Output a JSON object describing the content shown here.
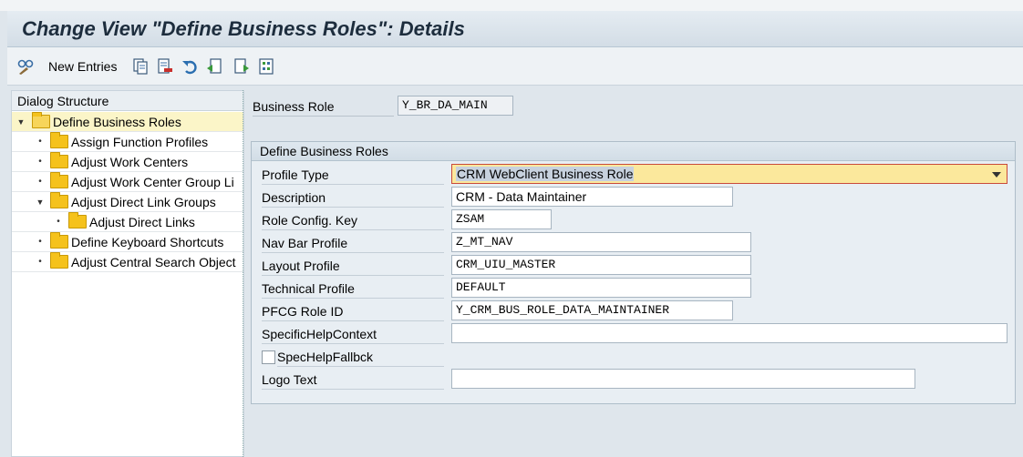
{
  "title": "Change View \"Define Business Roles\": Details",
  "toolbar": {
    "new_entries_label": "New Entries",
    "icons": [
      "glasses-icon",
      "copy-icon",
      "delete-icon",
      "undo-icon",
      "prev-entry-icon",
      "next-entry-icon",
      "select-block-icon"
    ]
  },
  "dialog_structure": {
    "header": "Dialog Structure",
    "items": [
      {
        "label": "Define Business Roles",
        "level": 0,
        "expanded": true,
        "selected": true
      },
      {
        "label": "Assign Function Profiles",
        "level": 1
      },
      {
        "label": "Adjust Work Centers",
        "level": 1
      },
      {
        "label": "Adjust Work Center Group Li",
        "level": 1
      },
      {
        "label": "Adjust Direct Link Groups",
        "level": 1,
        "expanded": true
      },
      {
        "label": "Adjust Direct Links",
        "level": 2
      },
      {
        "label": "Define Keyboard Shortcuts",
        "level": 1
      },
      {
        "label": "Adjust Central Search Object",
        "level": 1
      }
    ]
  },
  "business_role": {
    "label": "Business Role",
    "value": "Y_BR_DA_MAIN"
  },
  "group": {
    "title": "Define Business Roles",
    "fields": {
      "profile_type": {
        "label": "Profile Type",
        "value": "CRM WebClient Business Role"
      },
      "description": {
        "label": "Description",
        "value": "CRM - Data Maintainer"
      },
      "role_config_key": {
        "label": "Role Config. Key",
        "value": "ZSAM"
      },
      "nav_bar_profile": {
        "label": "Nav Bar Profile",
        "value": "Z_MT_NAV"
      },
      "layout_profile": {
        "label": "Layout Profile",
        "value": "CRM_UIU_MASTER"
      },
      "technical_profile": {
        "label": "Technical Profile",
        "value": "DEFAULT"
      },
      "pfcg_role_id": {
        "label": "PFCG Role ID",
        "value": "Y_CRM_BUS_ROLE_DATA_MAINTAINER"
      },
      "specific_help_context": {
        "label": "SpecificHelpContext",
        "value": ""
      },
      "spec_help_fallback": {
        "label": "SpecHelpFallbck",
        "checked": false
      },
      "logo_text": {
        "label": "Logo Text",
        "value": ""
      }
    }
  },
  "colors": {
    "selected_row": "#fbf5c8",
    "folder": "#f5c21c",
    "dropdown_bg": "#fbe89c",
    "dropdown_border": "#c94a3a"
  }
}
